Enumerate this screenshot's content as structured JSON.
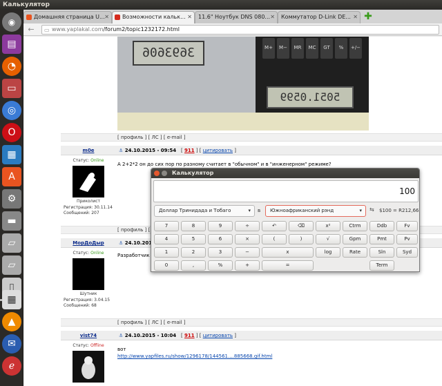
{
  "window_title": "Калькулятор",
  "tabs": [
    {
      "label": "Домашняя страница U...",
      "active": false,
      "color": "#e95420"
    },
    {
      "label": "Возможности кальк...",
      "active": true,
      "color": "#d52b1e"
    },
    {
      "label": "11.6\" Ноутбук DNS 080...",
      "active": false,
      "color": "#999999"
    },
    {
      "label": "Коммутатор D-Link DE...",
      "active": false,
      "color": "#999999"
    }
  ],
  "url": {
    "host": "www.yaplakal.com",
    "path": "/forum2/topic1232172.html"
  },
  "photo": {
    "lcd1": "3693606",
    "lcd2": "5051.0599"
  },
  "profile_links": "[ профиль ] [ ЛС ] [ e-mail ]",
  "posts": [
    {
      "nick": "m0e",
      "date": "24.10.2015 - 09:54",
      "rep": "911",
      "quote": "цитировать",
      "status_label": "Статус:",
      "status": "Online",
      "rank": "Приколист",
      "reg_label": "Регистрация: 30.11.14",
      "msgs_label": "Сообщений: 207",
      "text": "А 2+2*2 он до сих пор по разному считает в \"обычном\" и в \"инженерном\" режиме?"
    },
    {
      "nick": "МорДоДыр",
      "date": "24.10.2015",
      "status_label": "Статус:",
      "status": "Online",
      "rank": "Шутник",
      "reg_label": "Регистрация: 3.04.15",
      "msgs_label": "Сообщений: 68",
      "text": "Разработчик"
    },
    {
      "nick": "vist74",
      "date": "24.10.2015 - 10:04",
      "rep": "911",
      "quote": "цитировать",
      "status_label": "Статус:",
      "status": "Offline",
      "text": "вот",
      "link": "http://www.yapfiles.ru/show/1296178/144561....885668.gif.html"
    }
  ],
  "calculator": {
    "title": "Калькулятор",
    "display_value": "100",
    "from_currency": "Доллар Тринидада и Тобаго",
    "in_label": "в",
    "to_currency": "Южноафриканский рэнд",
    "rate": "$100 = R212,66",
    "keys": [
      [
        "7",
        "8",
        "9",
        "÷",
        "↶",
        "⌫",
        "x²",
        "Ctrm",
        "Ddb",
        "Fv"
      ],
      [
        "4",
        "5",
        "6",
        "×",
        "(",
        ")",
        "√",
        "Gpm",
        "Pmt",
        "Pv"
      ],
      [
        "1",
        "2",
        "3",
        "−",
        "x",
        "log",
        "Rate",
        "Sln",
        "Syd"
      ],
      [
        "0",
        ",",
        "%",
        "+",
        "=",
        "Term"
      ]
    ]
  }
}
